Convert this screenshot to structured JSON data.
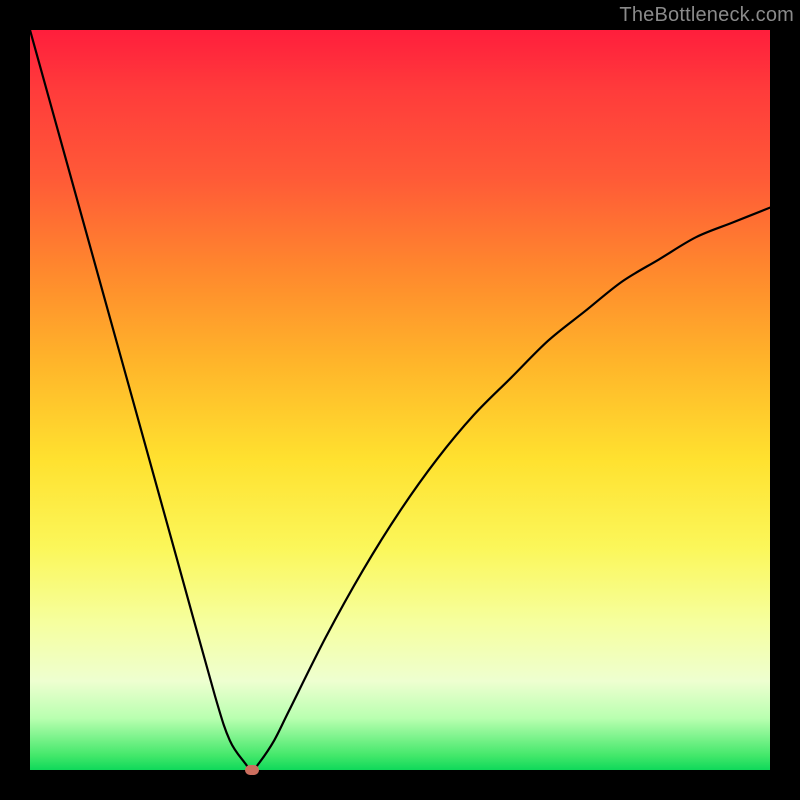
{
  "watermark": "TheBottleneck.com",
  "gradient_colors": {
    "top": "#ff1e3c",
    "mid_upper": "#ff8a2d",
    "mid": "#ffe12f",
    "mid_lower": "#f6ff9e",
    "bottom": "#0fd95a"
  },
  "marker_color": "#cc6e5e",
  "curve_color": "#000000",
  "chart_data": {
    "type": "line",
    "title": "",
    "xlabel": "",
    "ylabel": "",
    "xlim": [
      0,
      100
    ],
    "ylim": [
      0,
      100
    ],
    "x": [
      0,
      5,
      10,
      15,
      20,
      25,
      27,
      29,
      30,
      31,
      33,
      35,
      40,
      45,
      50,
      55,
      60,
      65,
      70,
      75,
      80,
      85,
      90,
      95,
      100
    ],
    "y": [
      100,
      82,
      64,
      46,
      28,
      10,
      4,
      1,
      0,
      1,
      4,
      8,
      18,
      27,
      35,
      42,
      48,
      53,
      58,
      62,
      66,
      69,
      72,
      74,
      76
    ],
    "minimum_marker": {
      "x": 30,
      "y": 0
    },
    "grid": false,
    "legend": false
  }
}
